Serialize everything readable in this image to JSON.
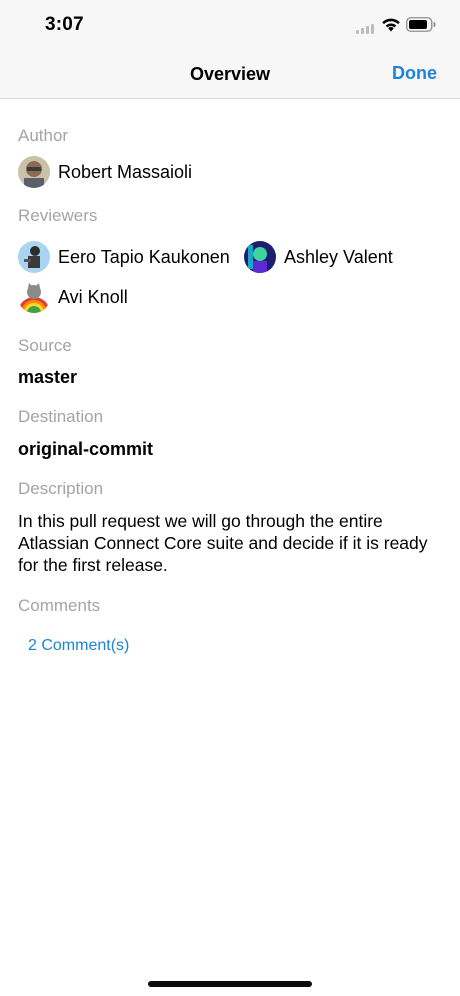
{
  "status_bar": {
    "time": "3:07"
  },
  "nav": {
    "title": "Overview",
    "done_label": "Done"
  },
  "author": {
    "label": "Author",
    "name": "Robert Massaioli"
  },
  "reviewers": {
    "label": "Reviewers",
    "items": [
      {
        "name": "Eero Tapio Kaukonen"
      },
      {
        "name": "Ashley Valent"
      },
      {
        "name": "Avi Knoll"
      }
    ]
  },
  "source": {
    "label": "Source",
    "value": "master"
  },
  "destination": {
    "label": "Destination",
    "value": "original-commit"
  },
  "description": {
    "label": "Description",
    "text": "In this pull request we will go through the entire Atlassian Connect Core suite and decide if it is ready for the first release."
  },
  "comments": {
    "label": "Comments",
    "link_label": "2 Comment(s)"
  },
  "colors": {
    "accent": "#1b84d8",
    "section_label": "#a4a4a4"
  }
}
